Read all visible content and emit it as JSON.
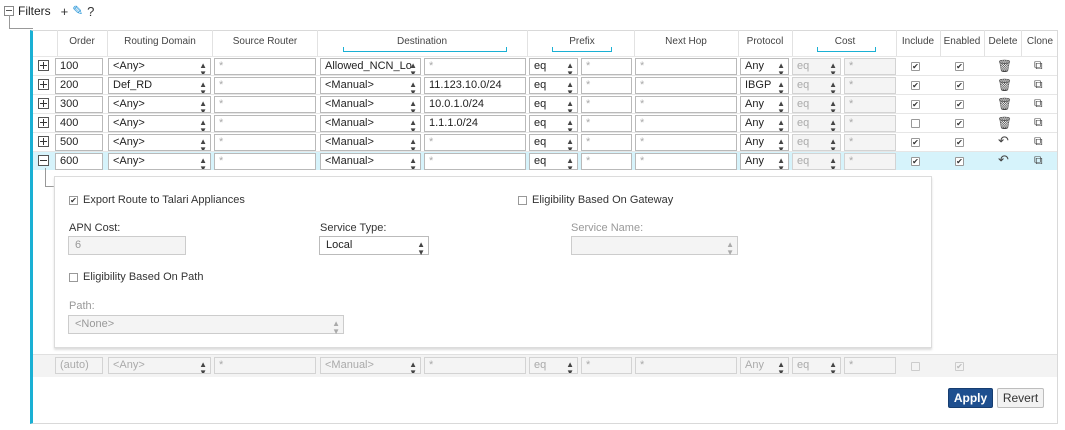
{
  "header": {
    "title": "Filters",
    "add": "+",
    "help": "?"
  },
  "columns": {
    "order": "Order",
    "routing_domain": "Routing Domain",
    "source_router": "Source Router",
    "destination": "Destination",
    "prefix": "Prefix",
    "next_hop": "Next Hop",
    "protocol": "Protocol",
    "cost": "Cost",
    "include": "Include",
    "enabled": "Enabled",
    "delete": "Delete",
    "clone": "Clone"
  },
  "rows": [
    {
      "order": "100",
      "domain": "<Any>",
      "source": "*",
      "dest": "Allowed_NCN_Lo",
      "dest_ip": "*",
      "prefix": "eq",
      "prefix_val": "*",
      "next_hop": "*",
      "protocol": "Any",
      "cost_op": "eq",
      "cost": "*",
      "include": true,
      "enabled": true,
      "action": "trash"
    },
    {
      "order": "200",
      "domain": "Def_RD",
      "source": "*",
      "dest": "<Manual>",
      "dest_ip": "11.123.10.0/24",
      "prefix": "eq",
      "prefix_val": "*",
      "next_hop": "*",
      "protocol": "IBGP",
      "cost_op": "eq",
      "cost": "*",
      "include": true,
      "enabled": true,
      "action": "trash"
    },
    {
      "order": "300",
      "domain": "<Any>",
      "source": "*",
      "dest": "<Manual>",
      "dest_ip": "10.0.1.0/24",
      "prefix": "eq",
      "prefix_val": "*",
      "next_hop": "*",
      "protocol": "Any",
      "cost_op": "eq",
      "cost": "*",
      "include": true,
      "enabled": true,
      "action": "trash"
    },
    {
      "order": "400",
      "domain": "<Any>",
      "source": "*",
      "dest": "<Manual>",
      "dest_ip": "1.1.1.0/24",
      "prefix": "eq",
      "prefix_val": "*",
      "next_hop": "*",
      "protocol": "Any",
      "cost_op": "eq",
      "cost": "*",
      "include": false,
      "enabled": true,
      "action": "trash"
    },
    {
      "order": "500",
      "domain": "<Any>",
      "source": "*",
      "dest": "<Manual>",
      "dest_ip": "*",
      "prefix": "eq",
      "prefix_val": "*",
      "next_hop": "*",
      "protocol": "Any",
      "cost_op": "eq",
      "cost": "*",
      "include": true,
      "enabled": true,
      "action": "undo"
    },
    {
      "order": "600",
      "domain": "<Any>",
      "source": "*",
      "dest": "<Manual>",
      "dest_ip": "*",
      "prefix": "eq",
      "prefix_val": "*",
      "next_hop": "*",
      "protocol": "Any",
      "cost_op": "eq",
      "cost": "*",
      "include": true,
      "enabled": true,
      "action": "undo"
    }
  ],
  "detail": {
    "export_label": "Export Route to Talari Appliances",
    "gateway_label": "Eligibility Based On Gateway",
    "apn_cost_label": "APN Cost:",
    "apn_cost_value": "6",
    "service_type_label": "Service Type:",
    "service_type_value": "Local",
    "service_name_label": "Service Name:",
    "service_name_value": "",
    "path_elig_label": "Eligibility Based On Path",
    "path_label": "Path:",
    "path_value": "<None>"
  },
  "new_row": {
    "order": "(auto)",
    "domain": "<Any>",
    "source": "*",
    "dest": "<Manual>",
    "dest_ip": "*",
    "prefix": "eq",
    "prefix_val": "*",
    "next_hop": "*",
    "protocol": "Any",
    "cost_op": "eq",
    "cost": "*"
  },
  "buttons": {
    "apply": "Apply",
    "revert": "Revert"
  },
  "colors": {
    "accent": "#1ab0d4",
    "primary_button": "#1e4f8f",
    "selected_row": "#d6f3fb"
  }
}
